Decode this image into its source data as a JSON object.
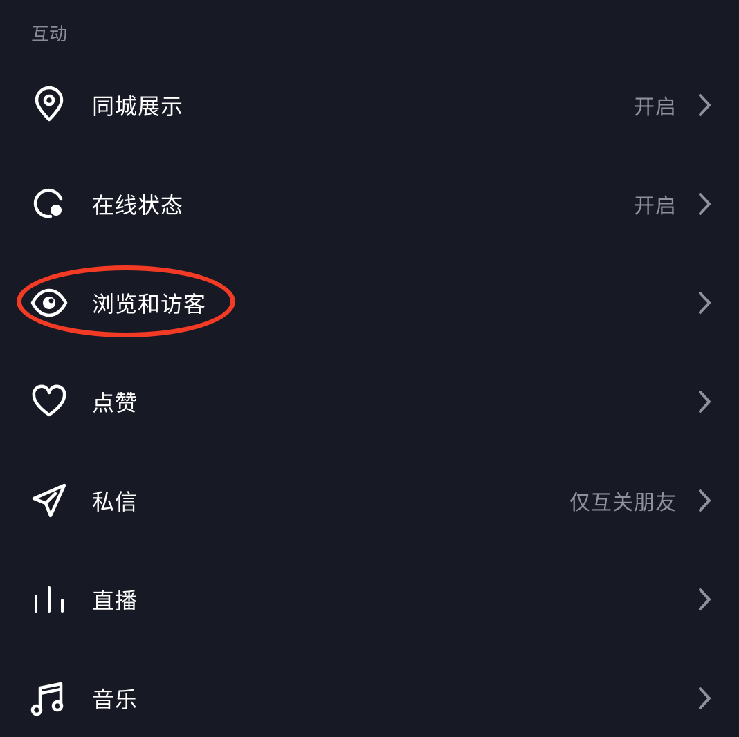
{
  "section": {
    "title": "互动"
  },
  "items": [
    {
      "icon": "location-pin-icon",
      "label": "同城展示",
      "value": "开启"
    },
    {
      "icon": "online-status-icon",
      "label": "在线状态",
      "value": "开启"
    },
    {
      "icon": "eye-icon",
      "label": "浏览和访客",
      "value": ""
    },
    {
      "icon": "heart-icon",
      "label": "点赞",
      "value": ""
    },
    {
      "icon": "paper-plane-icon",
      "label": "私信",
      "value": "仅互关朋友"
    },
    {
      "icon": "live-bars-icon",
      "label": "直播",
      "value": ""
    },
    {
      "icon": "music-note-icon",
      "label": "音乐",
      "value": ""
    }
  ],
  "colors": {
    "background": "#171a25",
    "text": "#ffffff",
    "secondary_text": "#8f929b",
    "highlight": "#f23a25"
  }
}
